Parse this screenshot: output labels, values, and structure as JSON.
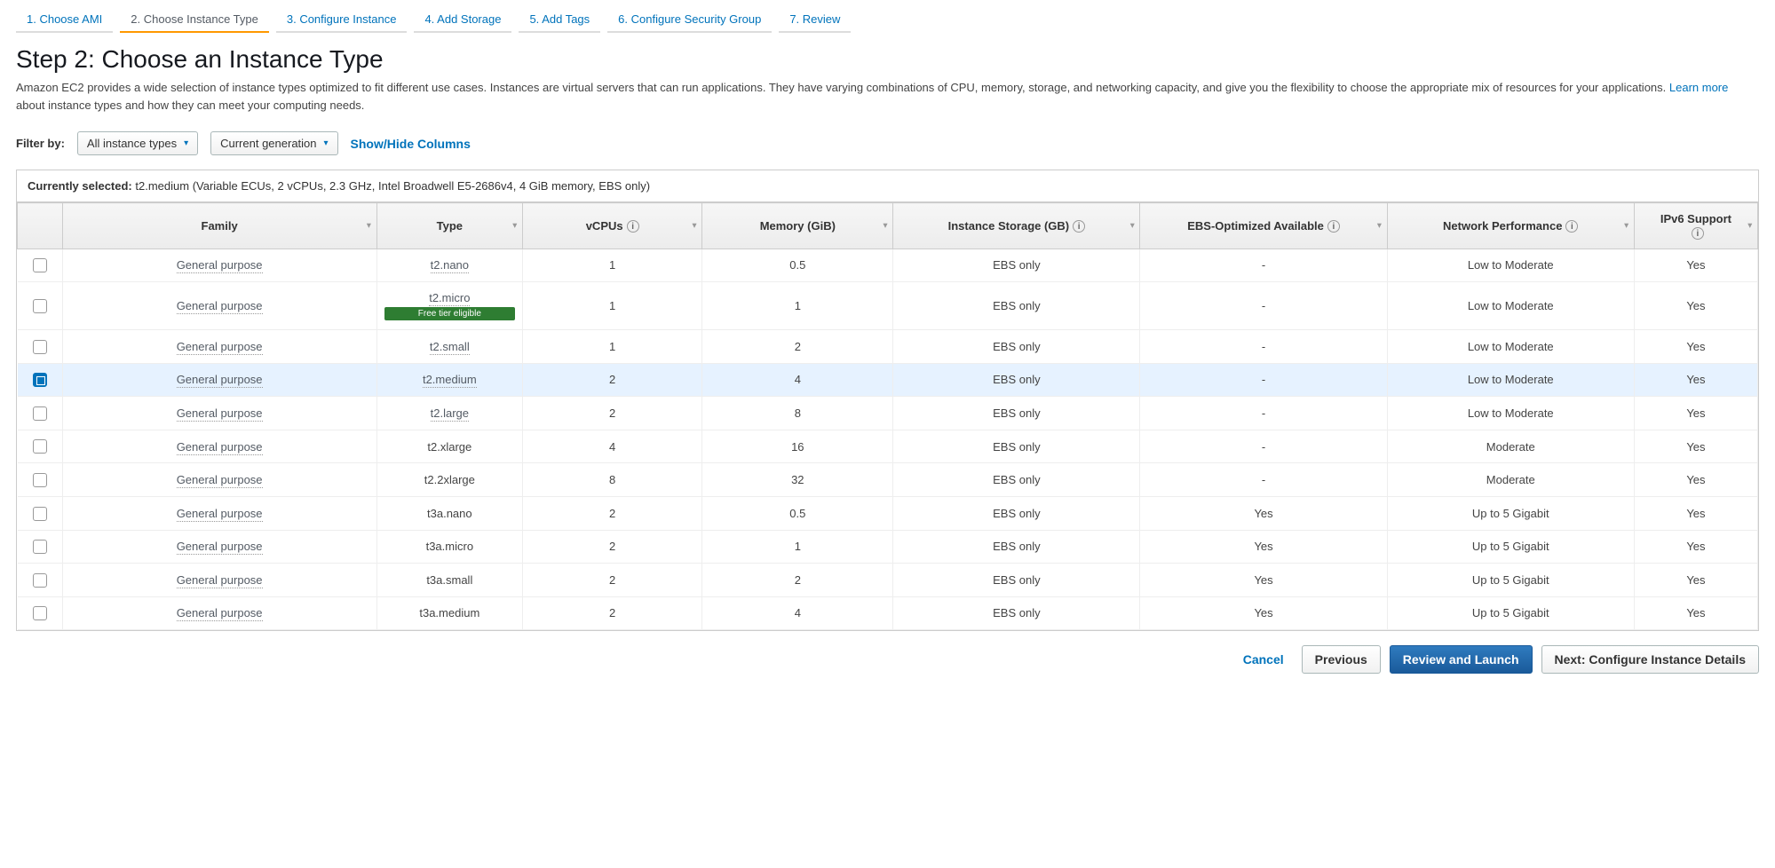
{
  "tabs": [
    {
      "label": "1. Choose AMI",
      "active": false
    },
    {
      "label": "2. Choose Instance Type",
      "active": true
    },
    {
      "label": "3. Configure Instance",
      "active": false
    },
    {
      "label": "4. Add Storage",
      "active": false
    },
    {
      "label": "5. Add Tags",
      "active": false
    },
    {
      "label": "6. Configure Security Group",
      "active": false
    },
    {
      "label": "7. Review",
      "active": false
    }
  ],
  "heading": "Step 2: Choose an Instance Type",
  "description_prefix": "Amazon EC2 provides a wide selection of instance types optimized to fit different use cases. Instances are virtual servers that can run applications. They have varying combinations of CPU, memory, storage, and networking capacity, and give you the flexibility to choose the appropriate mix of resources for your applications. ",
  "learn_more": "Learn more",
  "description_suffix": " about instance types and how they can meet your computing needs.",
  "filter": {
    "label": "Filter by:",
    "all_types": "All instance types",
    "generation": "Current generation",
    "show_hide": "Show/Hide Columns"
  },
  "currently_selected": {
    "label": "Currently selected:",
    "value": "t2.medium (Variable ECUs, 2 vCPUs, 2.3 GHz, Intel Broadwell E5-2686v4, 4 GiB memory, EBS only)"
  },
  "columns": {
    "family": "Family",
    "type": "Type",
    "vcpus": "vCPUs",
    "memory": "Memory (GiB)",
    "storage": "Instance Storage (GB)",
    "ebs": "EBS-Optimized Available",
    "network": "Network Performance",
    "ipv6": "IPv6 Support"
  },
  "rows": [
    {
      "family": "General purpose",
      "type": "t2.nano",
      "badge": "",
      "vcpus": "1",
      "memory": "0.5",
      "storage": "EBS only",
      "ebs": "-",
      "network": "Low to Moderate",
      "ipv6": "Yes",
      "selected": false,
      "dottedType": true
    },
    {
      "family": "General purpose",
      "type": "t2.micro",
      "badge": "Free tier eligible",
      "vcpus": "1",
      "memory": "1",
      "storage": "EBS only",
      "ebs": "-",
      "network": "Low to Moderate",
      "ipv6": "Yes",
      "selected": false,
      "dottedType": true
    },
    {
      "family": "General purpose",
      "type": "t2.small",
      "badge": "",
      "vcpus": "1",
      "memory": "2",
      "storage": "EBS only",
      "ebs": "-",
      "network": "Low to Moderate",
      "ipv6": "Yes",
      "selected": false,
      "dottedType": true
    },
    {
      "family": "General purpose",
      "type": "t2.medium",
      "badge": "",
      "vcpus": "2",
      "memory": "4",
      "storage": "EBS only",
      "ebs": "-",
      "network": "Low to Moderate",
      "ipv6": "Yes",
      "selected": true,
      "dottedType": true
    },
    {
      "family": "General purpose",
      "type": "t2.large",
      "badge": "",
      "vcpus": "2",
      "memory": "8",
      "storage": "EBS only",
      "ebs": "-",
      "network": "Low to Moderate",
      "ipv6": "Yes",
      "selected": false,
      "dottedType": true
    },
    {
      "family": "General purpose",
      "type": "t2.xlarge",
      "badge": "",
      "vcpus": "4",
      "memory": "16",
      "storage": "EBS only",
      "ebs": "-",
      "network": "Moderate",
      "ipv6": "Yes",
      "selected": false,
      "dottedType": false
    },
    {
      "family": "General purpose",
      "type": "t2.2xlarge",
      "badge": "",
      "vcpus": "8",
      "memory": "32",
      "storage": "EBS only",
      "ebs": "-",
      "network": "Moderate",
      "ipv6": "Yes",
      "selected": false,
      "dottedType": false
    },
    {
      "family": "General purpose",
      "type": "t3a.nano",
      "badge": "",
      "vcpus": "2",
      "memory": "0.5",
      "storage": "EBS only",
      "ebs": "Yes",
      "network": "Up to 5 Gigabit",
      "ipv6": "Yes",
      "selected": false,
      "dottedType": false
    },
    {
      "family": "General purpose",
      "type": "t3a.micro",
      "badge": "",
      "vcpus": "2",
      "memory": "1",
      "storage": "EBS only",
      "ebs": "Yes",
      "network": "Up to 5 Gigabit",
      "ipv6": "Yes",
      "selected": false,
      "dottedType": false
    },
    {
      "family": "General purpose",
      "type": "t3a.small",
      "badge": "",
      "vcpus": "2",
      "memory": "2",
      "storage": "EBS only",
      "ebs": "Yes",
      "network": "Up to 5 Gigabit",
      "ipv6": "Yes",
      "selected": false,
      "dottedType": false
    },
    {
      "family": "General purpose",
      "type": "t3a.medium",
      "badge": "",
      "vcpus": "2",
      "memory": "4",
      "storage": "EBS only",
      "ebs": "Yes",
      "network": "Up to 5 Gigabit",
      "ipv6": "Yes",
      "selected": false,
      "dottedType": false
    }
  ],
  "footer": {
    "cancel": "Cancel",
    "previous": "Previous",
    "review": "Review and Launch",
    "next": "Next: Configure Instance Details"
  }
}
